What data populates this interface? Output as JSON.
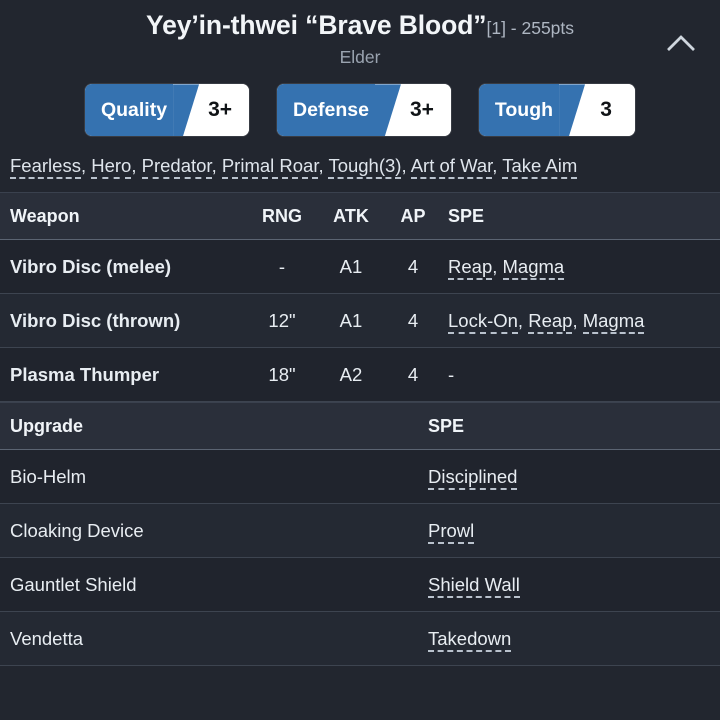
{
  "header": {
    "unit_name": "Yey’in-thwei “Brave Blood”",
    "unit_meta": "[1] - 255pts",
    "unit_subtitle": "Elder",
    "collapse_icon": "chevron-up-icon"
  },
  "stats": [
    {
      "label": "Quality",
      "value": "3+"
    },
    {
      "label": "Defense",
      "value": "3+"
    },
    {
      "label": "Tough",
      "value": "3"
    }
  ],
  "special_rules": [
    "Fearless",
    "Hero",
    "Predator",
    "Primal Roar",
    "Tough(3)",
    "Art of War",
    "Take Aim"
  ],
  "weapons": {
    "headers": [
      "Weapon",
      "RNG",
      "ATK",
      "AP",
      "SPE"
    ],
    "rows": [
      {
        "name": "Vibro Disc (melee)",
        "rng": "-",
        "atk": "A1",
        "ap": "4",
        "spe": [
          "Reap",
          "Magma"
        ],
        "spe_plain": ""
      },
      {
        "name": "Vibro Disc (thrown)",
        "rng": "12\"",
        "atk": "A1",
        "ap": "4",
        "spe": [
          "Lock-On",
          "Reap",
          "Magma"
        ],
        "spe_plain": ""
      },
      {
        "name": "Plasma Thumper",
        "rng": "18\"",
        "atk": "A2",
        "ap": "4",
        "spe": [],
        "spe_plain": "-"
      }
    ]
  },
  "upgrades": {
    "headers": [
      "Upgrade",
      "SPE"
    ],
    "rows": [
      {
        "name": "Bio-Helm",
        "spe": [
          "Disciplined"
        ]
      },
      {
        "name": "Cloaking Device",
        "spe": [
          "Prowl"
        ]
      },
      {
        "name": "Gauntlet Shield",
        "spe": [
          "Shield Wall"
        ]
      },
      {
        "name": "Vendetta",
        "spe": [
          "Takedown"
        ]
      }
    ]
  },
  "colors": {
    "background": "#22262f",
    "accent_blue": "#3572b0",
    "badge_value_bg": "#ffffff",
    "header_row_bg": "#2a2f3a",
    "text_primary": "#e8edf2",
    "text_muted": "#9aa3b0"
  }
}
